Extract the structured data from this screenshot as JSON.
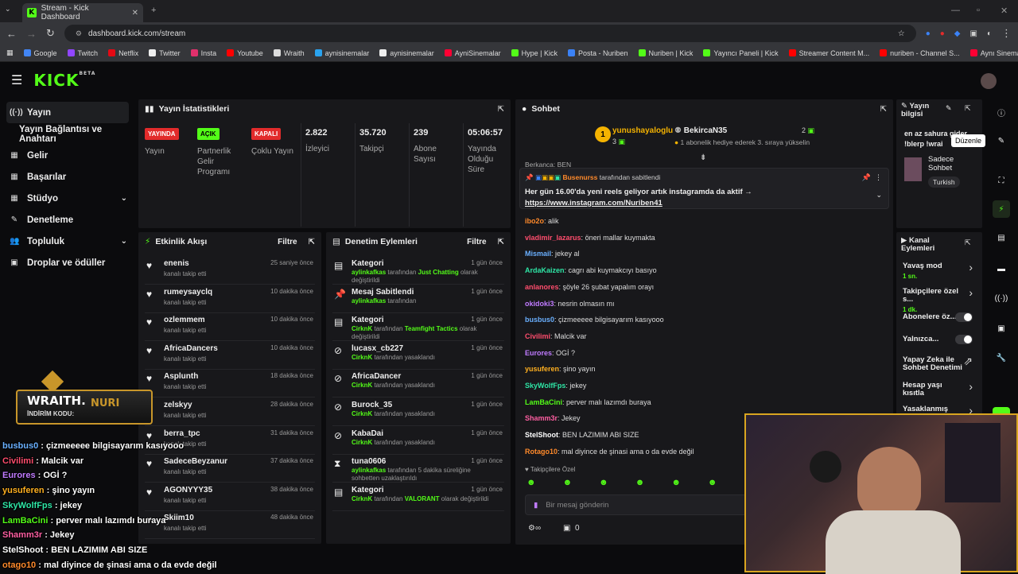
{
  "browser": {
    "tab_title": "Stream - Kick Dashboard",
    "url": "dashboard.kick.com/stream",
    "bookmarks": [
      "Google",
      "Twitch",
      "Netflix",
      "Twitter",
      "Insta",
      "Youtube",
      "Wraith",
      "aynisinemalar",
      "aynisinemalar",
      "AyniSinemalar",
      "Hype | Kick",
      "Posta - Nuriben",
      "Nuriben | Kick",
      "Yayıncı Paneli | Kick",
      "Streamer Content M...",
      "nuriben - Channel S...",
      "Aynı Sinemalar - Ça..."
    ],
    "bookmark_colors": [
      "#4285f4",
      "#9146ff",
      "#e50914",
      "#eeeeee",
      "#e1306c",
      "#ff0000",
      "#dddddd",
      "#2aa3ef",
      "#eeeeee",
      "#ff0033",
      "#53fc18",
      "#3b82f6",
      "#53fc18",
      "#53fc18",
      "#ff0000",
      "#ff0000",
      "#ff0033"
    ]
  },
  "logo": "KICK",
  "logo_beta": "BETA",
  "sidebar": [
    {
      "label": "Yayın",
      "icon": "((·))",
      "active": true
    },
    {
      "label": "Yayın Bağlantısı ve Anahtarı",
      "icon": ""
    },
    {
      "label": "Gelir",
      "icon": "▦"
    },
    {
      "label": "Başarılar",
      "icon": "▦"
    },
    {
      "label": "Stüdyo",
      "icon": "▦",
      "chev": "⌄"
    },
    {
      "label": "Denetleme",
      "icon": "✎"
    },
    {
      "label": "Topluluk",
      "icon": "👥",
      "chev": "⌄"
    },
    {
      "label": "Droplar ve ödüller",
      "icon": "▣"
    }
  ],
  "stats": {
    "title": "Yayın İstatistikleri",
    "items": [
      {
        "badge": "YAYINDA",
        "badge_color": "#e22b2b",
        "badge_text_color": "#ffffff",
        "label": "Yayın"
      },
      {
        "badge": "AÇIK",
        "badge_color": "#53fc18",
        "badge_text_color": "#000000",
        "label": "Partnerlik Gelir Programı"
      },
      {
        "badge": "KAPALI",
        "badge_color": "#e22b2b",
        "badge_text_color": "#ffffff",
        "label": "Çoklu Yayın"
      },
      {
        "value": "2.822",
        "label": "İzleyici"
      },
      {
        "value": "35.720",
        "label": "Takipçi"
      },
      {
        "value": "239",
        "label": "Abone Sayısı"
      },
      {
        "value": "05:06:57",
        "label": "Yayında Olduğu Süre"
      }
    ]
  },
  "activity": {
    "title": "Etkinlik Akışı",
    "filter": "Filtre",
    "rows": [
      {
        "name": "enenis",
        "sub": "kanalı takip etti",
        "time": "25 saniye önce"
      },
      {
        "name": "rumeysayclq",
        "sub": "kanalı takip etti",
        "time": "10 dakika önce"
      },
      {
        "name": "ozlemmem",
        "sub": "kanalı takip etti",
        "time": "10 dakika önce"
      },
      {
        "name": "AfricaDancers",
        "sub": "kanalı takip etti",
        "time": "10 dakika önce"
      },
      {
        "name": "Asplunth",
        "sub": "kanalı takip etti",
        "time": "18 dakika önce"
      },
      {
        "name": "zelskyy",
        "sub": "kanalı takip etti",
        "time": "28 dakika önce"
      },
      {
        "name": "berra_tpc",
        "sub": "kanalı takip etti",
        "time": "31 dakika önce"
      },
      {
        "name": "SadeceBeyzanur",
        "sub": "kanalı takip etti",
        "time": "37 dakika önce"
      },
      {
        "name": "AGONYYY35",
        "sub": "kanalı takip etti",
        "time": "38 dakika önce"
      },
      {
        "name": "Skiim10",
        "sub": "kanalı takip etti",
        "time": "48 dakika önce"
      }
    ]
  },
  "moderation": {
    "title": "Denetim Eylemleri",
    "filter": "Filtre",
    "rows": [
      {
        "icon": "▤",
        "name": "Kategori",
        "user": "aylinkafkas",
        "mid": " tarafından ",
        "hl": "Just Chatting",
        "end": " olarak değiştirildi",
        "time": "1 gün önce"
      },
      {
        "icon": "📌",
        "name": "Mesaj Sabitlendi",
        "user": "aylinkafkas",
        "mid": " tarafından",
        "hl": "",
        "end": "",
        "time": "1 gün önce"
      },
      {
        "icon": "▤",
        "name": "Kategori",
        "user": "CirknK",
        "mid": " tarafından ",
        "hl": "Teamfight Tactics",
        "end": " olarak değiştirildi",
        "time": "1 gün önce"
      },
      {
        "icon": "⊘",
        "name": "lucasx_cb227",
        "user": "CirknK",
        "mid": " tarafından yasaklandı",
        "hl": "",
        "end": "",
        "time": "1 gün önce"
      },
      {
        "icon": "⊘",
        "name": "AfricaDancer",
        "user": "CirknK",
        "mid": " tarafından yasaklandı",
        "hl": "",
        "end": "",
        "time": "1 gün önce"
      },
      {
        "icon": "⊘",
        "name": "Burock_35",
        "user": "CirknK",
        "mid": " tarafından yasaklandı",
        "hl": "",
        "end": "",
        "time": "1 gün önce"
      },
      {
        "icon": "⊘",
        "name": "KabaDai",
        "user": "CirknK",
        "mid": " tarafından yasaklandı",
        "hl": "",
        "end": "",
        "time": "1 gün önce"
      },
      {
        "icon": "⧗",
        "name": "tuna0606",
        "user": "aylinkafkas",
        "mid": " tarafından 5 dakika süreliğine sohbetten uzaklaştırıldı",
        "hl": "",
        "end": "",
        "time": "1 gün önce"
      },
      {
        "icon": "▤",
        "name": "Kategori",
        "user": "CirknK",
        "mid": " tarafından ",
        "hl": "VALORANT",
        "end": " olarak değiştirildi",
        "time": "1 gün önce"
      }
    ]
  },
  "chat": {
    "title": "Sohbet",
    "top1": {
      "rank": "1",
      "name": "yunushayaloglu",
      "count": "3"
    },
    "top2": {
      "name": "BekircaN35",
      "count": "2",
      "note": "1 abonelik hediye ederek 3. sıraya yükselin"
    },
    "cut_user": "Berkanca: BEN",
    "pinned_by": "Busenurss",
    "pinned_suffix": " tarafından sabitlendi",
    "pinned_text": "Her gün 16.00'da yeni reels geliyor artık instagramda da aktif →",
    "pinned_link": "https://www.instagram.com/Nuriben41",
    "messages": [
      {
        "user": "ibo2o",
        "color": "#ff8a2b",
        "text": "alik"
      },
      {
        "user": "vladimir_lazarus",
        "color": "#ff4d6d",
        "text": "öneri mallar kuymakta"
      },
      {
        "user": "Mismail",
        "color": "#6ab0ff",
        "text": "jekey al"
      },
      {
        "user": "ArdaKaizen",
        "color": "#2ee6a6",
        "text": "cagrı abi kuymakcıyı basıyo"
      },
      {
        "user": "anlanores",
        "color": "#ff4d6d",
        "text": "şöyle 26 şubat yapalım orayı"
      },
      {
        "user": "okidoki3",
        "color": "#c07bff",
        "text": "nesrin olmasın mı"
      },
      {
        "user": "busbus0",
        "color": "#6ab0ff",
        "text": "çizmeeeee bilgisayarım kasıyooo"
      },
      {
        "user": "Civilimi",
        "color": "#ff4d6d",
        "text": "Malcik var"
      },
      {
        "user": "Eurores",
        "color": "#c07bff",
        "text": "OGİ ?"
      },
      {
        "user": "yusuferen",
        "color": "#ffb020",
        "text": "şino yayın"
      },
      {
        "user": "SkyWolfFps",
        "color": "#2ee6a6",
        "text": "jekey"
      },
      {
        "user": "LamBaCini",
        "color": "#53fc18",
        "text": "perver malı lazımdı buraya"
      },
      {
        "user": "Shamm3r",
        "color": "#ff5fa2",
        "text": "Jekey"
      },
      {
        "user": "StelShoot",
        "color": "#ffffff",
        "text": "BEN LAZIMIM ABI SIZE"
      },
      {
        "user": "Rotago10",
        "color": "#ff8a2b",
        "text": "mal diyince de şinasi ama o da evde değil"
      }
    ],
    "followers_only": "Takipçilere Özel",
    "input_placeholder": "Bir mesaj gönderin",
    "count": "0"
  },
  "stream_info": {
    "title": "Yayın bilgisi",
    "text1": "en az sahura gider",
    "text2": "!blerp !wrai",
    "tooltip": "Düzenle",
    "category": "Sadece Sohbet",
    "language": "Turkish"
  },
  "channel_actions": {
    "title": "Kanal Eylemleri",
    "items": [
      {
        "label": "Yavaş mod",
        "sub": "1 sn.",
        "type": "chev"
      },
      {
        "label": "Takipçilere özel s...",
        "sub": "1 dk.",
        "type": "chev"
      },
      {
        "label": "Abonelere öz...",
        "sub": "",
        "type": "toggle"
      },
      {
        "label": "Yalnızca...",
        "sub": "",
        "type": "toggle"
      },
      {
        "label": "Yapay Zeka ile Sohbet Denetimi",
        "sub": "",
        "type": "ext"
      },
      {
        "label": "Hesap yaşı kısıtla",
        "sub": "",
        "type": "chev"
      },
      {
        "label": "Yasaklanmış kelin...",
        "sub": "",
        "type": "chev"
      }
    ]
  },
  "overlay": {
    "banner_brand": "WRAITH.",
    "banner_code_label": "İNDİRİM KODU:",
    "banner_code": "NURI",
    "lines": [
      {
        "user": "busbus0",
        "text": " : çizmeeeee bilgisayarım kasıyooo",
        "color": "#6ab0ff"
      },
      {
        "user": "Civilimi",
        "text": " : Malcik var",
        "color": "#ff4d6d"
      },
      {
        "user": "Eurores",
        "text": " : OGİ ?",
        "color": "#c07bff"
      },
      {
        "user": "yusuferen",
        "text": " : şino yayın",
        "color": "#ffb020"
      },
      {
        "user": "SkyWolfFps",
        "text": " : jekey",
        "color": "#2ee6a6"
      },
      {
        "user": "LamBaCini",
        "text": " : perver malı lazımdı buraya",
        "color": "#53fc18"
      },
      {
        "user": "Shamm3r",
        "text": " : Jekey",
        "color": "#ff5fa2"
      },
      {
        "user": "StelShoot",
        "text": " : BEN LAZIMIM ABI SIZE",
        "color": "#ffffff"
      },
      {
        "user": "otago10",
        "text": " : mal diyince de şinasi ama o da evde değil",
        "color": "#ff8a2b"
      }
    ]
  }
}
